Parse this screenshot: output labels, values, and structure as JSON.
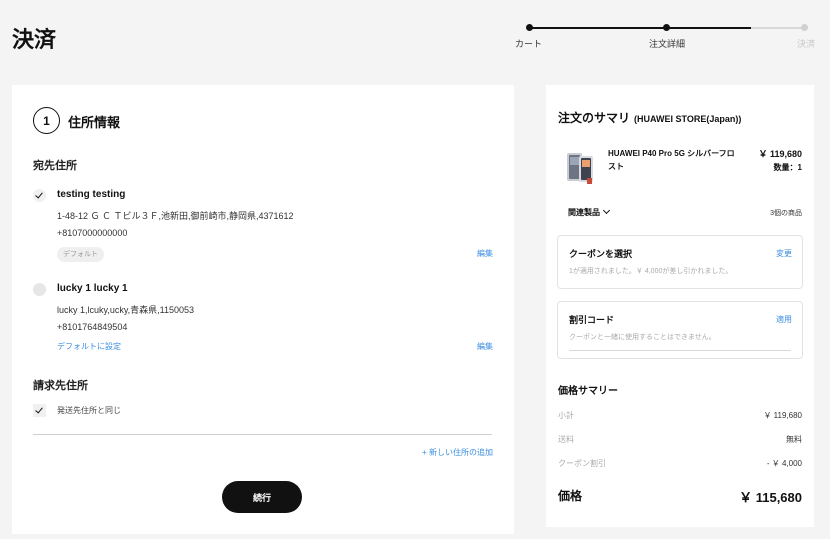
{
  "page_title": "決済",
  "steps": [
    {
      "label": "カート",
      "state": "done"
    },
    {
      "label": "注文詳細",
      "state": "current"
    },
    {
      "label": "決済",
      "state": "upcoming"
    }
  ],
  "address_section": {
    "step_number": "1",
    "title": "住所情報",
    "shipping_title": "宛先住所",
    "addresses": [
      {
        "name": "testing testing",
        "address": "1-48-12 Ｇ Ｃ Ｔビル３Ｆ,池新田,御前崎市,静岡県,4371612",
        "phone": "+8107000000000",
        "badge": "デフォルト",
        "edit": "編集",
        "selected": true
      },
      {
        "name": "lucky 1 lucky 1",
        "address": "lucky 1,lcuky,ucky,青森県,1150053",
        "phone": "+8101764849504",
        "set_default": "デフォルトに設定",
        "edit": "編集",
        "selected": false
      }
    ],
    "billing_title": "請求先住所",
    "same_as_shipping": "発送先住所と同じ",
    "add_address": "+ 新しい住所の追加",
    "continue": "続行"
  },
  "summary": {
    "title": "注文のサマリ",
    "store": "(HUAWEI STORE(Japan))",
    "product": {
      "name": "HUAWEI P40 Pro 5G シルバーフロスト",
      "price": "￥ 119,680",
      "qty": "数量：1"
    },
    "related_label": "関連製品",
    "related_count": "3個の商品",
    "coupon": {
      "title": "クーポンを選択",
      "action": "変更",
      "note": "1が適用されました。￥ 4,000が差し引かれました。"
    },
    "discount_code": {
      "title": "割引コード",
      "action": "適用",
      "note": "クーポンと一緒に使用することはできません。"
    },
    "price_summary_title": "価格サマリー",
    "rows": [
      {
        "label": "小計",
        "value": "￥ 119,680"
      },
      {
        "label": "送料",
        "value": "無料"
      },
      {
        "label": "クーポン割引",
        "value": "- ￥ 4,000"
      }
    ],
    "total_label": "価格",
    "total_value": "￥ 115,680"
  },
  "colors": {
    "accent_link": "#3a8de0",
    "primary_button": "#111111"
  }
}
